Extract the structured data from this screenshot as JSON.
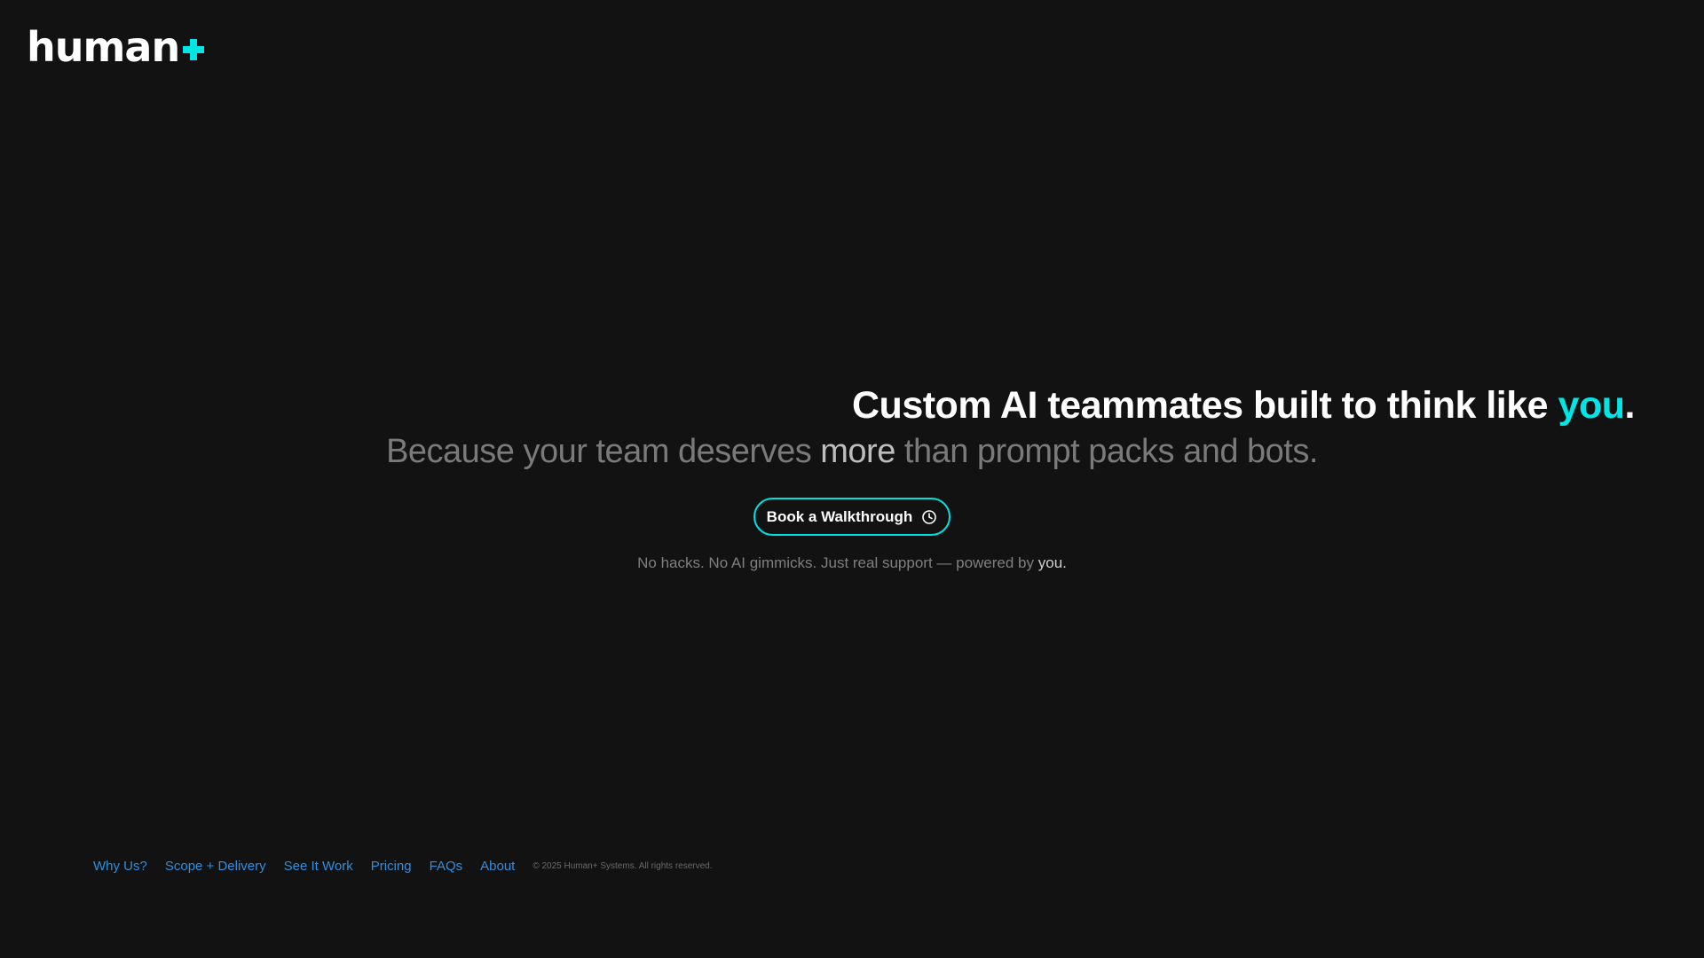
{
  "logo": {
    "text": "human",
    "icon": "plus-icon",
    "accent_color": "#00e5e5"
  },
  "hero": {
    "headline_main": "Custom AI teammates built to think like ",
    "headline_accent": "you",
    "headline_end": ".",
    "sub_before": "Because your team deserves ",
    "sub_emph": "more",
    "sub_after": " than prompt packs and bots.",
    "cta_label": "Book a Walkthrough",
    "cta_icon": "clock-icon",
    "tagline_before": "No hacks. No AI gimmicks. Just real support — powered by ",
    "tagline_emph": "you."
  },
  "footer": {
    "links": [
      "Why Us?",
      "Scope + Delivery",
      "See It Work",
      "Pricing",
      "FAQs",
      "About"
    ],
    "copyright": "© 2025 Human+ Systems. All rights reserved."
  },
  "colors": {
    "background": "#121212",
    "accent": "#00e5e5",
    "link": "#2f8fe0"
  }
}
